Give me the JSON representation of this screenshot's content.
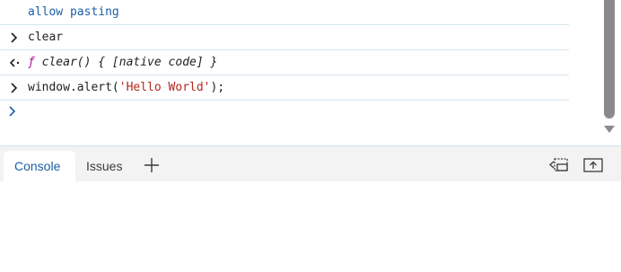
{
  "console": {
    "lines": [
      {
        "kind": "warning-text",
        "text": "allow pasting"
      },
      {
        "kind": "input",
        "text": "clear"
      },
      {
        "kind": "output",
        "f": "ƒ",
        "text": " clear() { [native code] }"
      },
      {
        "kind": "input",
        "prefix": "window.alert(",
        "string": "'Hello World'",
        "suffix": ");"
      }
    ]
  },
  "drawer": {
    "tabs": [
      {
        "label": "Console",
        "active": true
      },
      {
        "label": "Issues",
        "active": false
      }
    ]
  },
  "icons": {
    "input_prompt": "chevron-right-icon",
    "output_arrow": "return-arrow-icon",
    "add_tab": "plus-icon",
    "dock": "dock-side-icon",
    "undock": "undock-icon"
  },
  "colors": {
    "accent": "#1a5fa8",
    "string": "#b3261e",
    "function_keyword": "#a3159a",
    "divider": "#d6e6ee",
    "scrollbar": "#8a8a8a"
  }
}
